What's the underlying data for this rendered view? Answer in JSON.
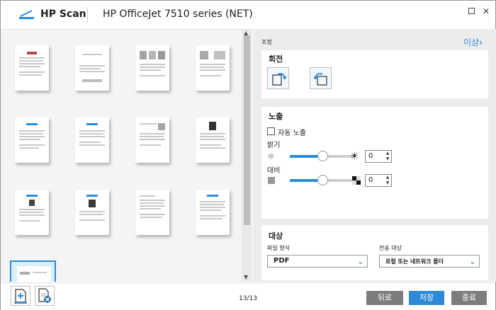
{
  "app": {
    "name": "HP Scan",
    "device": "HP OfficeJet 7510 series (NET)"
  },
  "right": {
    "adjust_label": "조정",
    "more_label": "이상",
    "rotate": {
      "title": "회전"
    },
    "exposure": {
      "title": "노출",
      "auto_label": "자동 노출",
      "brightness_label": "밝기",
      "brightness_value": "0",
      "brightness_level": 0.5,
      "contrast_label": "대비",
      "contrast_value": "0",
      "contrast_level": 0.5
    },
    "destination": {
      "title": "대상",
      "file_type_label": "파일 형식",
      "file_type_value": "PDF",
      "send_to_label": "전송 대상",
      "send_to_value": "로컬 또는 네트워크 폴더"
    }
  },
  "bottom": {
    "page_count": "13/13",
    "back": "뒤로",
    "save": "저장",
    "quit": "종료"
  },
  "colors": {
    "accent": "#2c8ad7",
    "button_gray": "#7d7d7d"
  }
}
